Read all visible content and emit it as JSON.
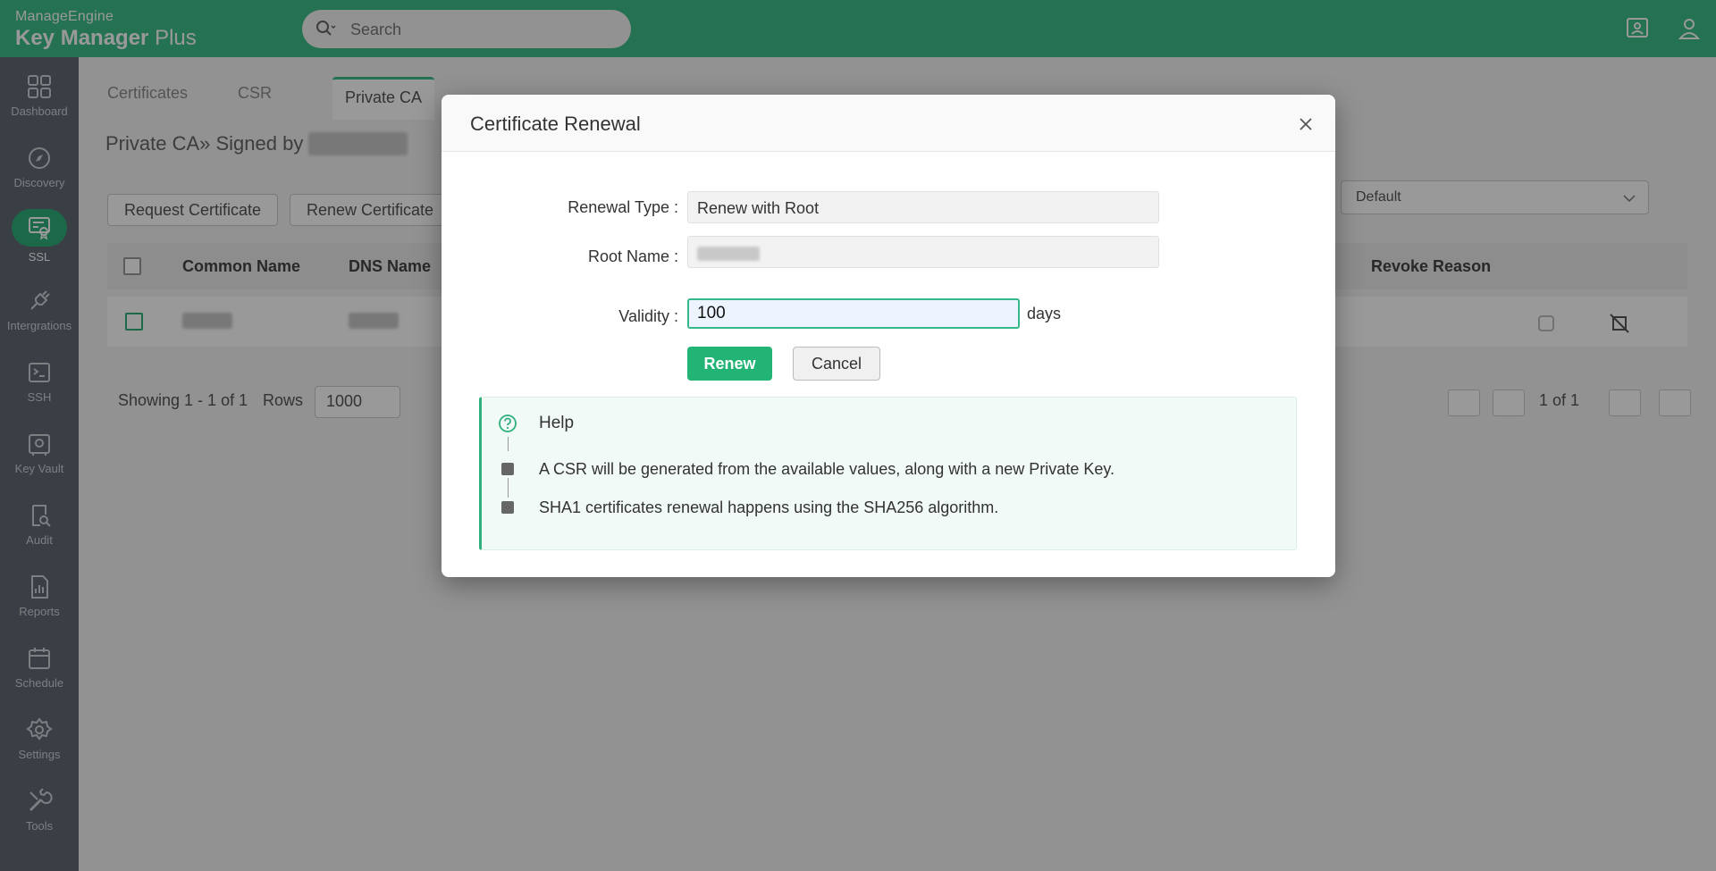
{
  "app": {
    "vendor": "ManageEngine",
    "product_bold": "Key Manager",
    "product_light": "Plus"
  },
  "search": {
    "placeholder": "Search"
  },
  "sidebar": {
    "items": [
      {
        "label": "Dashboard",
        "icon": "dashboard-icon"
      },
      {
        "label": "Discovery",
        "icon": "compass-icon"
      },
      {
        "label": "SSL",
        "icon": "certificate-icon",
        "active": true
      },
      {
        "label": "Intergrations",
        "icon": "plug-icon"
      },
      {
        "label": "SSH",
        "icon": "terminal-icon"
      },
      {
        "label": "Key Vault",
        "icon": "vault-icon"
      },
      {
        "label": "Audit",
        "icon": "audit-icon"
      },
      {
        "label": "Reports",
        "icon": "reports-icon"
      },
      {
        "label": "Schedule",
        "icon": "calendar-icon"
      },
      {
        "label": "Settings",
        "icon": "gear-icon"
      },
      {
        "label": "Tools",
        "icon": "tools-icon"
      }
    ]
  },
  "tabs": [
    "Certificates",
    "CSR",
    "Private CA"
  ],
  "breadcrumb": {
    "prefix": "Private CA» Signed by",
    "signer": "testoneroot"
  },
  "toolbar": {
    "request": "Request Certificate",
    "renew": "Renew Certificate",
    "view_select": "Default"
  },
  "table": {
    "headers": [
      "Common Name",
      "DNS Name",
      "Revoke Reason"
    ],
    "rows": [
      {
        "common_name": "hostsub",
        "dns_name": "hostsub"
      }
    ]
  },
  "pager": {
    "showing": "Showing 1 - 1 of 1",
    "rows_label": "Rows",
    "rows_value": "1000",
    "page": "1 of 1"
  },
  "modal": {
    "title": "Certificate Renewal",
    "renewal_type_label": "Renewal Type :",
    "renewal_type_value": "Renew with Root",
    "root_name_label": "Root Name :",
    "root_name_value": "testoneroot",
    "validity_label": "Validity :",
    "validity_value": "100",
    "validity_unit": "days",
    "renew_button": "Renew",
    "cancel_button": "Cancel",
    "help": {
      "title": "Help",
      "items": [
        "A CSR will be generated from the available values, along with a new Private Key.",
        "SHA1 certificates renewal happens using the SHA256 algorithm."
      ]
    }
  },
  "colors": {
    "brand": "#3fbf8a",
    "sidebar": "#606a73",
    "primary_button": "#22b474"
  }
}
